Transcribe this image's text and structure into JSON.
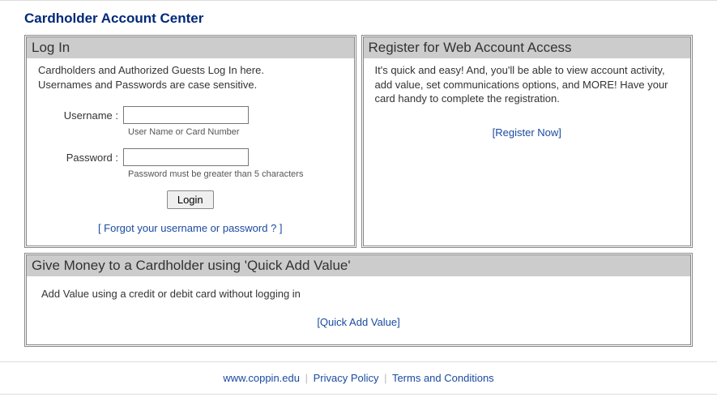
{
  "page": {
    "title": "Cardholder Account Center"
  },
  "login": {
    "header": "Log In",
    "instruction_line1": "Cardholders and Authorized Guests Log In here.",
    "instruction_line2": "Usernames and Passwords are case sensitive.",
    "username_label": "Username :",
    "username_value": "",
    "username_hint": "User Name or Card Number",
    "password_label": "Password :",
    "password_value": "",
    "password_hint": "Password must be greater than 5 characters",
    "login_button": "Login",
    "forgot_link": "[ Forgot your username or password ? ]"
  },
  "register": {
    "header": "Register for Web Account Access",
    "body": "It's quick and easy! And, you'll be able to view account activity, add value, set communications options, and MORE! Have your card handy to complete the registration.",
    "link": "[Register Now]"
  },
  "quick_add": {
    "header": "Give Money to a Cardholder using 'Quick Add Value'",
    "body": "Add Value using a credit or debit card without logging in",
    "link": "[Quick Add Value]"
  },
  "footer": {
    "link1": "www.coppin.edu",
    "link2": "Privacy Policy",
    "link3": "Terms and Conditions"
  }
}
